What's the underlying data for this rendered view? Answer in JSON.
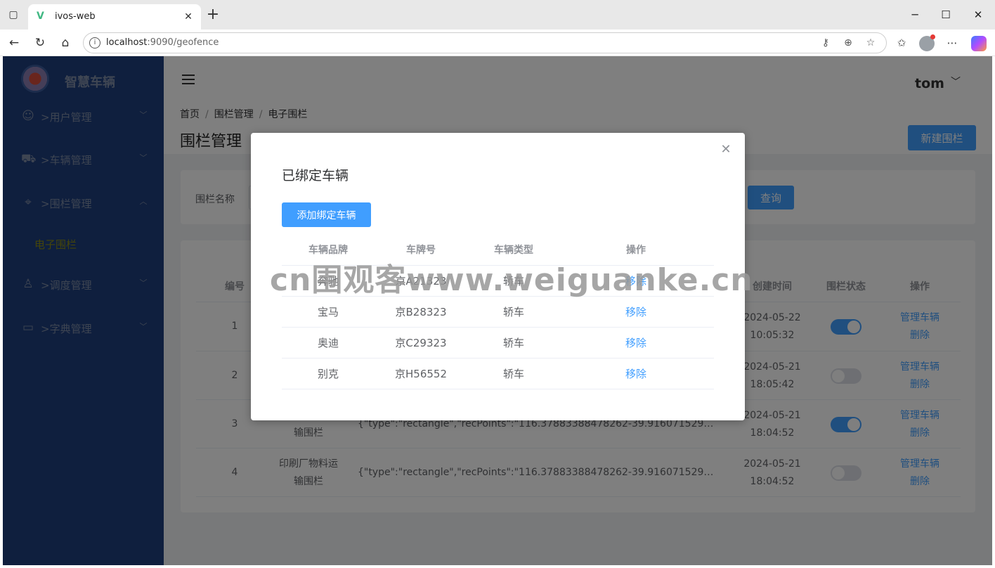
{
  "browser": {
    "tab_title": "ivos-web",
    "url_host": "localhost",
    "url_rest": ":9090/geofence"
  },
  "sidebar": {
    "logo_text": "智慧车辆",
    "items": [
      {
        "label": ">用户管理",
        "icon": "user-icon"
      },
      {
        "label": ">车辆管理",
        "icon": "truck-icon"
      },
      {
        "label": ">围栏管理",
        "icon": "location-pin-icon"
      },
      {
        "label": ">调度管理",
        "icon": "dispatch-icon"
      },
      {
        "label": ">字典管理",
        "icon": "box-icon"
      }
    ],
    "active_sub": "电子围栏"
  },
  "header": {
    "user": "tom"
  },
  "breadcrumb": [
    "首页",
    "围栏管理",
    "电子围栏"
  ],
  "page": {
    "title": "围栏管理",
    "new_button": "新建围栏"
  },
  "search": {
    "label": "围栏名称",
    "button": "查询"
  },
  "table": {
    "headers": {
      "id": "编号",
      "created": "创建时间",
      "status": "围栏状态",
      "actions": "操作"
    },
    "rows": [
      {
        "id": "1",
        "name": "",
        "json": "",
        "date": "2024-05-22",
        "time": "10:05:32",
        "enabled": true
      },
      {
        "id": "2",
        "name": "",
        "json": "",
        "date": "2024-05-21",
        "time": "18:05:42",
        "enabled": false
      },
      {
        "id": "3",
        "name": "输围栏",
        "json": "{\"type\":\"rectangle\",\"recPoints\":\"116.37883388478262-39.9160715294669…",
        "date": "2024-05-21",
        "time": "18:04:52",
        "enabled": true
      },
      {
        "id": "4",
        "name": "印刷厂物料运输围栏",
        "json": "{\"type\":\"rectangle\",\"recPoints\":\"116.37883388478262-39.9160715294669…",
        "date": "2024-05-21",
        "time": "18:04:52",
        "enabled": false
      }
    ],
    "action_manage": "管理车辆",
    "action_delete": "删除"
  },
  "dialog": {
    "title": "已绑定车辆",
    "add_button": "添加绑定车辆",
    "headers": {
      "brand": "车辆品牌",
      "plate": "车牌号",
      "type": "车辆类型",
      "op": "操作"
    },
    "rows": [
      {
        "brand": "奔驰",
        "plate": "京A21323",
        "type": "轿车"
      },
      {
        "brand": "宝马",
        "plate": "京B28323",
        "type": "轿车"
      },
      {
        "brand": "奥迪",
        "plate": "京C29323",
        "type": "轿车"
      },
      {
        "brand": "别克",
        "plate": "京H56552",
        "type": "轿车"
      }
    ],
    "remove_label": "移除"
  },
  "watermark": "cn围观客www.weiguanke.cn"
}
